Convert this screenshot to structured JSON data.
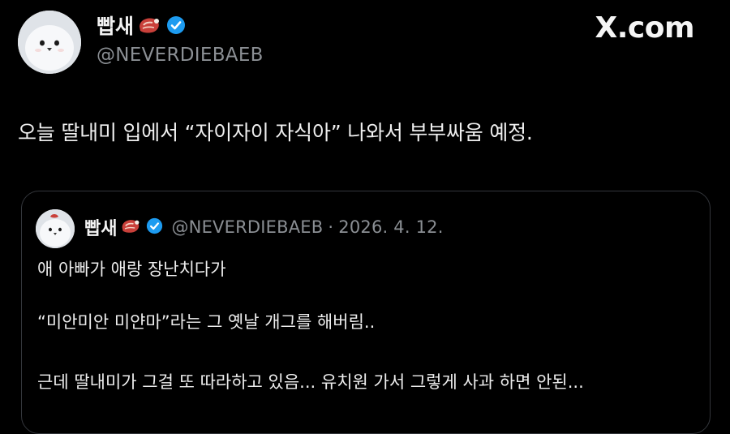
{
  "brand": {
    "label": "X.com"
  },
  "author": {
    "name": "빱새",
    "handle": "@NEVERDIEBAEB",
    "emoji_icon": "meat-icon",
    "verified_icon": "verified-icon",
    "verified_color": "#1d9bf0"
  },
  "tweet": {
    "text": "오늘 딸내미 입에서 “자이자이 자식아” 나와서 부부싸움 예정."
  },
  "quoted": {
    "name": "빱새",
    "handle": "@NEVERDIEBAEB",
    "separator": "·",
    "date": "2026. 4. 12.",
    "lines": [
      "애 아빠가 애랑 장난치다가",
      "“미안미안 미얀마”라는 그 옛날 개그를 해버림..",
      "근데 딸내미가 그걸 또 따라하고 있음... 유치원 가서 그렇게 사과 하면 안된..."
    ]
  },
  "colors": {
    "background": "#000000",
    "text": "#e7e9ea",
    "secondary_text": "#8b8f94",
    "card_border": "#33363b"
  }
}
